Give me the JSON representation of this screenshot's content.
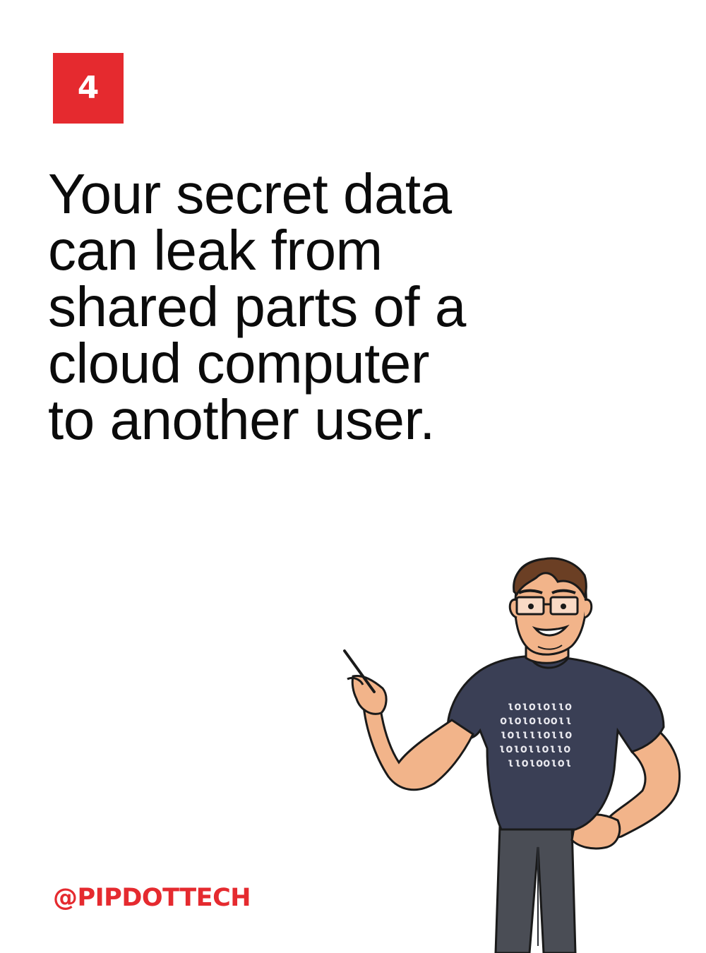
{
  "slide": {
    "number": "4",
    "headline_lines": [
      "Your secret data",
      "can leak from",
      "shared parts of a",
      "cloud computer",
      "to another user."
    ],
    "handle": "@PIPDOTTECH"
  },
  "character": {
    "icon": "nerd-presenter-illustration",
    "shirt_binary_lines": [
      "ιοιοιοιιο",
      "οιοιοιοοιι",
      "ιοιιιιοιιο",
      "ιοιοιιοιιο",
      "ιιοιοοιοι"
    ]
  },
  "colors": {
    "accent": "#e52a2f",
    "text": "#0b0b0b",
    "background": "#ffffff",
    "shirt": "#3a3f55",
    "skin": "#f2b48a",
    "hair": "#6b3f24",
    "pants": "#4a4d55"
  }
}
